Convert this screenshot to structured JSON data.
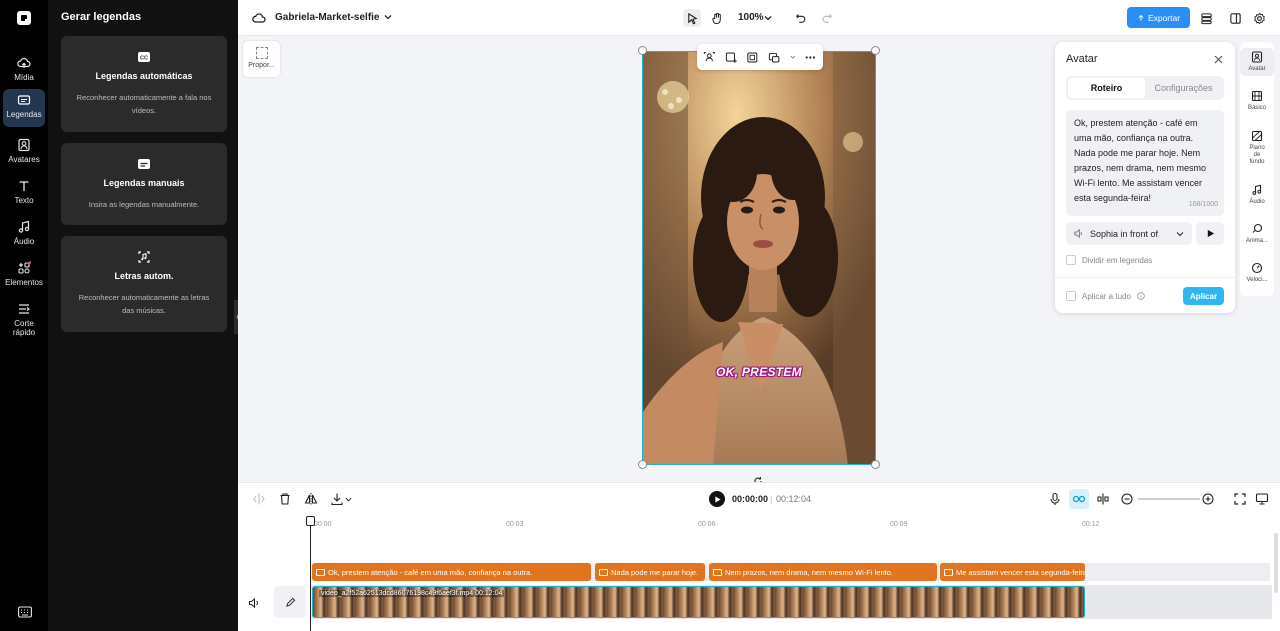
{
  "rail": {
    "items": [
      {
        "label": "Mídia"
      },
      {
        "label": "Legendas"
      },
      {
        "label": "Avatares"
      },
      {
        "label": "Texto"
      },
      {
        "label": "Áudio"
      },
      {
        "label": "Elementos"
      },
      {
        "label": "Corte rápido"
      }
    ]
  },
  "panel": {
    "title": "Gerar legendas",
    "cards": [
      {
        "title": "Legendas automáticas",
        "desc": "Reconhecer automaticamente a fala nos vídeos."
      },
      {
        "title": "Legendas manuais",
        "desc": "Insira as legendas manualmente."
      },
      {
        "title": "Letras autom.",
        "desc": "Reconhecer automaticamente as letras das músicas."
      }
    ]
  },
  "topbar": {
    "project_name": "Gabriela-Market-selfie",
    "zoom": "100%",
    "export_label": "Exportar"
  },
  "canvas": {
    "proportion_label": "Propor...",
    "subtitle_preview": "OK, PRESTEM"
  },
  "avatar_panel": {
    "title": "Avatar",
    "tabs": [
      {
        "label": "Roteiro"
      },
      {
        "label": "Configurações"
      }
    ],
    "script": "Ok, prestem atenção - café em uma mão, confiança na outra. Nada pode me parar hoje. Nem prazos, nem drama, nem mesmo Wi-Fi lento. Me assistam vencer esta segunda-feira!",
    "char_count": "168/1000",
    "voice": "Sophia in front of",
    "split_label": "Dividir em legendas",
    "apply_all_label": "Aplicar a tudo",
    "apply_label": "Aplicar"
  },
  "right_rail": {
    "items": [
      {
        "label": "Avatar"
      },
      {
        "label": "Básico"
      },
      {
        "label": "Plano de fundo"
      },
      {
        "label": "Áudio"
      },
      {
        "label": "Anima..."
      },
      {
        "label": "Veloci..."
      }
    ]
  },
  "timeline": {
    "current_time": "00:00:00",
    "separator": "|",
    "duration": "00:12:04",
    "ticks": [
      "00:00",
      "00:03",
      "00:06",
      "00:09",
      "00:12"
    ],
    "subtitle_clips": [
      {
        "text": "Ok, prestem atenção - café em uma mão, confiança na outra."
      },
      {
        "text": "Nada pode me parar hoje."
      },
      {
        "text": "Nem prazos, nem drama, nem mesmo Wi-Fi lento."
      },
      {
        "text": "Me assistam vencer esta segunda-feira!"
      }
    ],
    "video_clip_label": "video_a2f52a62513dcd86076198c49f6aef3f.mp4   00:12:04"
  },
  "colors": {
    "accent": "#2b8ef5",
    "selection": "#20b0c8",
    "subtitle_clip": "#e0741f",
    "apply_button": "#2fb6ee"
  }
}
